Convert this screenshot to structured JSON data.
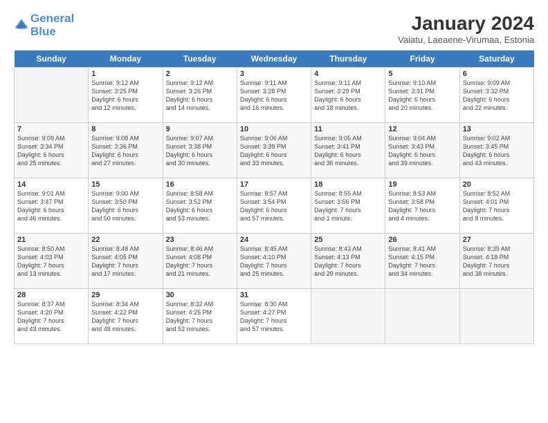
{
  "header": {
    "logo_line1": "General",
    "logo_line2": "Blue",
    "month_year": "January 2024",
    "location": "Vaiatu, Laeaene-Virumaa, Estonia"
  },
  "days_of_week": [
    "Sunday",
    "Monday",
    "Tuesday",
    "Wednesday",
    "Thursday",
    "Friday",
    "Saturday"
  ],
  "weeks": [
    [
      {
        "day": "",
        "info": ""
      },
      {
        "day": "1",
        "info": "Sunrise: 9:12 AM\nSunset: 3:25 PM\nDaylight: 6 hours\nand 12 minutes."
      },
      {
        "day": "2",
        "info": "Sunrise: 9:12 AM\nSunset: 3:26 PM\nDaylight: 6 hours\nand 14 minutes."
      },
      {
        "day": "3",
        "info": "Sunrise: 9:11 AM\nSunset: 3:28 PM\nDaylight: 6 hours\nand 16 minutes."
      },
      {
        "day": "4",
        "info": "Sunrise: 9:11 AM\nSunset: 3:29 PM\nDaylight: 6 hours\nand 18 minutes."
      },
      {
        "day": "5",
        "info": "Sunrise: 9:10 AM\nSunset: 3:31 PM\nDaylight: 6 hours\nand 20 minutes."
      },
      {
        "day": "6",
        "info": "Sunrise: 9:09 AM\nSunset: 3:32 PM\nDaylight: 6 hours\nand 22 minutes."
      }
    ],
    [
      {
        "day": "7",
        "info": "Sunrise: 9:09 AM\nSunset: 3:34 PM\nDaylight: 6 hours\nand 25 minutes."
      },
      {
        "day": "8",
        "info": "Sunrise: 9:08 AM\nSunset: 3:36 PM\nDaylight: 6 hours\nand 27 minutes."
      },
      {
        "day": "9",
        "info": "Sunrise: 9:07 AM\nSunset: 3:38 PM\nDaylight: 6 hours\nand 30 minutes."
      },
      {
        "day": "10",
        "info": "Sunrise: 9:06 AM\nSunset: 3:39 PM\nDaylight: 6 hours\nand 33 minutes."
      },
      {
        "day": "11",
        "info": "Sunrise: 9:05 AM\nSunset: 3:41 PM\nDaylight: 6 hours\nand 36 minutes."
      },
      {
        "day": "12",
        "info": "Sunrise: 9:04 AM\nSunset: 3:43 PM\nDaylight: 6 hours\nand 39 minutes."
      },
      {
        "day": "13",
        "info": "Sunrise: 9:02 AM\nSunset: 3:45 PM\nDaylight: 6 hours\nand 43 minutes."
      }
    ],
    [
      {
        "day": "14",
        "info": "Sunrise: 9:01 AM\nSunset: 3:47 PM\nDaylight: 6 hours\nand 46 minutes."
      },
      {
        "day": "15",
        "info": "Sunrise: 9:00 AM\nSunset: 3:50 PM\nDaylight: 6 hours\nand 50 minutes."
      },
      {
        "day": "16",
        "info": "Sunrise: 8:58 AM\nSunset: 3:52 PM\nDaylight: 6 hours\nand 53 minutes."
      },
      {
        "day": "17",
        "info": "Sunrise: 8:57 AM\nSunset: 3:54 PM\nDaylight: 6 hours\nand 57 minutes."
      },
      {
        "day": "18",
        "info": "Sunrise: 8:55 AM\nSunset: 3:56 PM\nDaylight: 7 hours\nand 1 minute."
      },
      {
        "day": "19",
        "info": "Sunrise: 8:53 AM\nSunset: 3:58 PM\nDaylight: 7 hours\nand 4 minutes."
      },
      {
        "day": "20",
        "info": "Sunrise: 8:52 AM\nSunset: 4:01 PM\nDaylight: 7 hours\nand 8 minutes."
      }
    ],
    [
      {
        "day": "21",
        "info": "Sunrise: 8:50 AM\nSunset: 4:03 PM\nDaylight: 7 hours\nand 13 minutes."
      },
      {
        "day": "22",
        "info": "Sunrise: 8:48 AM\nSunset: 4:05 PM\nDaylight: 7 hours\nand 17 minutes."
      },
      {
        "day": "23",
        "info": "Sunrise: 8:46 AM\nSunset: 4:08 PM\nDaylight: 7 hours\nand 21 minutes."
      },
      {
        "day": "24",
        "info": "Sunrise: 8:45 AM\nSunset: 4:10 PM\nDaylight: 7 hours\nand 25 minutes."
      },
      {
        "day": "25",
        "info": "Sunrise: 8:43 AM\nSunset: 4:13 PM\nDaylight: 7 hours\nand 29 minutes."
      },
      {
        "day": "26",
        "info": "Sunrise: 8:41 AM\nSunset: 4:15 PM\nDaylight: 7 hours\nand 34 minutes."
      },
      {
        "day": "27",
        "info": "Sunrise: 8:39 AM\nSunset: 4:18 PM\nDaylight: 7 hours\nand 38 minutes."
      }
    ],
    [
      {
        "day": "28",
        "info": "Sunrise: 8:37 AM\nSunset: 4:20 PM\nDaylight: 7 hours\nand 43 minutes."
      },
      {
        "day": "29",
        "info": "Sunrise: 8:34 AM\nSunset: 4:22 PM\nDaylight: 7 hours\nand 48 minutes."
      },
      {
        "day": "30",
        "info": "Sunrise: 8:32 AM\nSunset: 4:25 PM\nDaylight: 7 hours\nand 52 minutes."
      },
      {
        "day": "31",
        "info": "Sunrise: 8:30 AM\nSunset: 4:27 PM\nDaylight: 7 hours\nand 57 minutes."
      },
      {
        "day": "",
        "info": ""
      },
      {
        "day": "",
        "info": ""
      },
      {
        "day": "",
        "info": ""
      }
    ]
  ]
}
